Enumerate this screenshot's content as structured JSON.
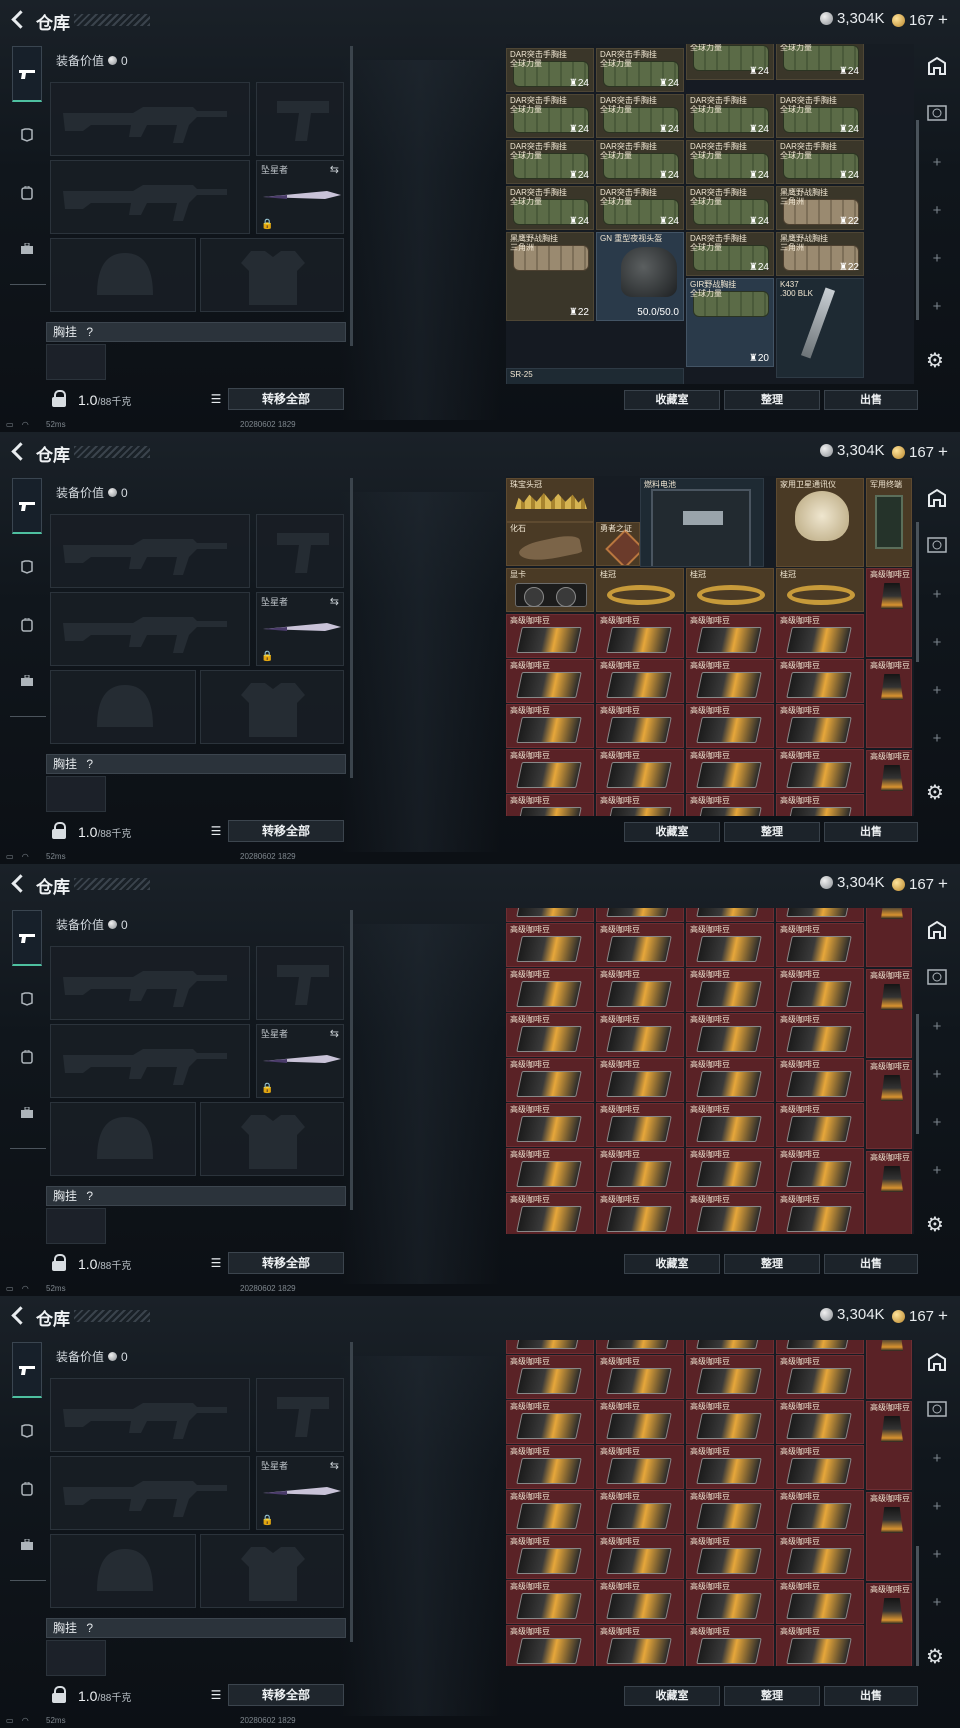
{
  "app": {
    "title": "仓库",
    "currency_silver": "3,304K",
    "currency_gold": "167",
    "plus_label": "+"
  },
  "equipment": {
    "value_label": "装备价值",
    "value": "0",
    "knife_label": "坠星者",
    "chest_label": "胸挂",
    "chest_hint": "?",
    "weight": "1.0",
    "weight_max": "/88千克",
    "transfer_all": "转移全部"
  },
  "status": {
    "ping": "52ms",
    "session_id": "20280602 1829"
  },
  "inventory": {
    "buttons": [
      "收藏室",
      "整理",
      "出售"
    ],
    "frame1_cells": [
      {
        "name": "DAR突击手胸挂\n全球力量",
        "stack": "24",
        "style": "green",
        "art": "bag"
      },
      {
        "name": "DAR突击手胸挂\n全球力量",
        "stack": "24",
        "style": "green",
        "art": "bag"
      },
      {
        "name": "DAR突击手胸挂\n全球力量",
        "stack": "24",
        "style": "green",
        "art": "bag"
      },
      {
        "name": "DAR突击手胸挂\n全球力量",
        "stack": "24",
        "style": "green",
        "art": "bag"
      },
      {
        "name": "DAR突击手胸挂\n全球力量",
        "stack": "24",
        "style": "green",
        "art": "bag"
      },
      {
        "name": "DAR突击手胸挂\n全球力量",
        "stack": "24",
        "style": "green",
        "art": "bag"
      },
      {
        "name": "DAR突击手胸挂\n全球力量",
        "stack": "24",
        "style": "green",
        "art": "bag"
      },
      {
        "name": "DAR突击手胸挂\n全球力量",
        "stack": "24",
        "style": "green",
        "art": "bag"
      },
      {
        "name": "DAR突击手胸挂\n全球力量",
        "stack": "24",
        "style": "green",
        "art": "bag"
      },
      {
        "name": "DAR突击手胸挂\n全球力量",
        "stack": "24",
        "style": "green",
        "art": "bag"
      },
      {
        "name": "DAR突击手胸挂\n全球力量",
        "stack": "24",
        "style": "green",
        "art": "bag"
      },
      {
        "name": "黑鹰野战胸挂\n三角洲",
        "stack": "22",
        "style": "green",
        "art": "tanbag"
      },
      {
        "name": "黑鹰野战胸挂\n三角洲",
        "stack": "22",
        "style": "green",
        "art": "tanbag"
      },
      {
        "name": "GN 重型夜视头盔",
        "dura": "50.0/50.0",
        "style": "blue",
        "art": "helmet"
      },
      {
        "name": "GIR野战胸挂\n全球力量",
        "stack": "20",
        "style": "blue",
        "art": "bag"
      },
      {
        "name": "K437\n.300 BLK",
        "style": "dark",
        "art": "rifle"
      },
      {
        "name": "SR-25",
        "style": "dark",
        "art": "none"
      }
    ],
    "frame2_top_cells": [
      {
        "name": "珠宝头冠",
        "style": "gold",
        "art": "crown"
      },
      {
        "name": "燃料电池",
        "style": "dark",
        "art": "battery"
      },
      {
        "name": "家用卫星通讯仪",
        "style": "gold",
        "art": "sat"
      },
      {
        "name": "军用终端",
        "style": "gold",
        "art": "terminal"
      },
      {
        "name": "化石",
        "style": "gold",
        "art": "fossil"
      },
      {
        "name": "勇者之证",
        "style": "gold",
        "art": "medal"
      },
      {
        "name": "显卡",
        "style": "gold",
        "art": "gpu"
      },
      {
        "name": "桂冠",
        "style": "gold",
        "art": "ring"
      },
      {
        "name": "桂冠",
        "style": "gold",
        "art": "ring"
      },
      {
        "name": "桂冠",
        "style": "gold",
        "art": "ring"
      }
    ],
    "coffee_name": "高级咖啡豆"
  },
  "nav": {
    "tabs": [
      "weapon-tab",
      "armor-tab",
      "backpack-tab",
      "toolbox-tab"
    ]
  }
}
